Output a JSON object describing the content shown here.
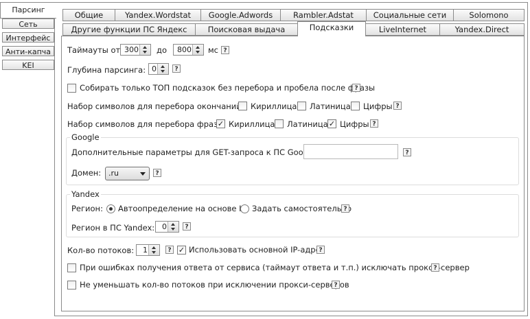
{
  "left_tabs": [
    "Парсинг",
    "Сеть",
    "Интерфейс",
    "Анти-капча",
    "KEI"
  ],
  "top_tabs_row1": [
    "Общие",
    "Yandex.Wordstat",
    "Google.Adwords",
    "Rambler.Adstat",
    "Социальные сети",
    "Solomono"
  ],
  "top_tabs_row2": [
    "Другие функции ПС Яндекс",
    "Поисковая выдача",
    "Подсказки",
    "LiveInternet",
    "Yandex.Direct"
  ],
  "help_glyph": "?",
  "check_glyph": "✓",
  "timeouts": {
    "label": "Таймауты от",
    "from": "300",
    "to_label": "до",
    "to": "800",
    "unit": "мс"
  },
  "depth": {
    "label": "Глубина парсинга:",
    "value": "0"
  },
  "top_only": {
    "label": "Собирать только ТОП подсказок без перебора и пробела после фразы",
    "checked": false
  },
  "endings": {
    "label": "Набор символов для перебора окончаний:",
    "cyr": "Кириллица",
    "lat": "Латиница",
    "dig": "Цифры",
    "cyr_checked": false,
    "lat_checked": false,
    "dig_checked": false
  },
  "phrases": {
    "label": "Набор символов для перебора фраз:",
    "cyr": "Кириллица",
    "lat": "Латиница",
    "dig": "Цифры",
    "cyr_checked": true,
    "lat_checked": false,
    "dig_checked": true
  },
  "google": {
    "title": "Google",
    "get_label": "Дополнительные параметры для GET-запроса к ПС Google:",
    "get_value": "",
    "domain_label": "Домен:",
    "domain_value": ".ru"
  },
  "yandex": {
    "title": "Yandex",
    "region_label": "Регион:",
    "auto": "Автоопределение на основе IP",
    "manual": "Задать самостоятельно",
    "selected": "auto",
    "region_ps_label": "Регион в ПС Yandex:",
    "region_ps_value": "0"
  },
  "threads": {
    "label": "Кол-во потоков:",
    "value": "1",
    "main_ip_label": "Использовать основной IP-адрес",
    "main_ip_checked": true
  },
  "exclude_proxy": {
    "label": "При ошибках получения ответа от сервиса (таймаут ответа и т.п.) исключать прокси-сервер",
    "checked": false
  },
  "keep_threads": {
    "label": "Не уменьшать кол-во потоков при исключении прокси-серверов",
    "checked": false
  }
}
